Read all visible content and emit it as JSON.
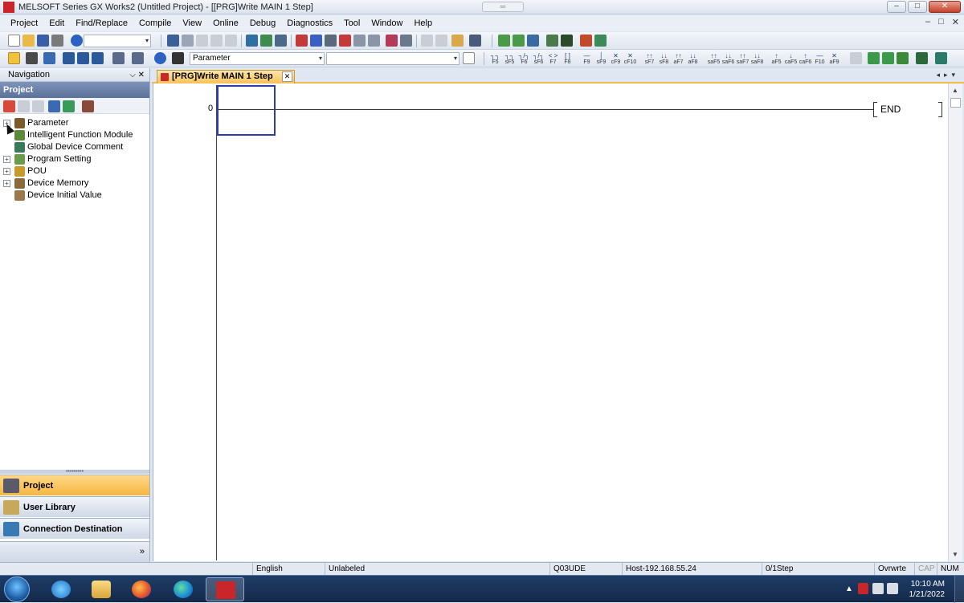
{
  "window": {
    "title": "MELSOFT Series GX Works2 (Untitled Project) - [[PRG]Write MAIN 1 Step]",
    "app_icon_text": "",
    "drag_handle": "═"
  },
  "window_controls": {
    "minimize": "–",
    "maximize": "□",
    "close": "✕"
  },
  "mdi_controls": {
    "minimize": "–",
    "restore": "□",
    "close": "✕"
  },
  "menu": [
    "Project",
    "Edit",
    "Find/Replace",
    "Compile",
    "View",
    "Online",
    "Debug",
    "Diagnostics",
    "Tool",
    "Window",
    "Help"
  ],
  "toolbar2": {
    "parameter_combo": "Parameter",
    "combo_arrow": "▾"
  },
  "fkeys": [
    {
      "sym": "┐┐",
      "key": "F5"
    },
    {
      "sym": "┐┐",
      "key": "sF5"
    },
    {
      "sym": "┐/┐",
      "key": "F6"
    },
    {
      "sym": "┐/┐",
      "key": "sF6"
    },
    {
      "sym": "< >",
      "key": "F7"
    },
    {
      "sym": "[ ]",
      "key": "F8"
    },
    {
      "sym": "—",
      "key": "F9"
    },
    {
      "sym": "│",
      "key": "sF9"
    },
    {
      "sym": "✕",
      "key": "cF9"
    },
    {
      "sym": "✕",
      "key": "cF10"
    },
    {
      "sym": "↑↑",
      "key": "sF7"
    },
    {
      "sym": "↓↓",
      "key": "sF8"
    },
    {
      "sym": "↑↑",
      "key": "aF7"
    },
    {
      "sym": "↓↓",
      "key": "aF8"
    },
    {
      "sym": "↑↑",
      "key": "saF5"
    },
    {
      "sym": "↓↓",
      "key": "saF6"
    },
    {
      "sym": "↑↑",
      "key": "saF7"
    },
    {
      "sym": "↓↓",
      "key": "saF8"
    },
    {
      "sym": "↑",
      "key": "aF5"
    },
    {
      "sym": "↓",
      "key": "caF5"
    },
    {
      "sym": "↑",
      "key": "caF6"
    },
    {
      "sym": "—",
      "key": "F10"
    },
    {
      "sym": "✕",
      "key": "aF9"
    }
  ],
  "navigation": {
    "title": "Navigation",
    "pin": "⌵",
    "close": "✕",
    "project_header": "Project",
    "tree": [
      {
        "label": "Parameter",
        "expander": "+",
        "color": "#7a5a2a"
      },
      {
        "label": "Intelligent Function Module",
        "expander": "",
        "color": "#5a8a3a"
      },
      {
        "label": "Global Device Comment",
        "expander": "",
        "color": "#3a7a5a"
      },
      {
        "label": "Program Setting",
        "expander": "+",
        "color": "#6a9a4a"
      },
      {
        "label": "POU",
        "expander": "+",
        "color": "#c89a2a"
      },
      {
        "label": "Device Memory",
        "expander": "+",
        "color": "#8a6a3a"
      },
      {
        "label": "Device Initial Value",
        "expander": "",
        "color": "#9a7a4a"
      }
    ],
    "splitter": "•••••••••",
    "tabs": [
      {
        "label": "Project",
        "active": true
      },
      {
        "label": "User Library",
        "active": false
      },
      {
        "label": "Connection Destination",
        "active": false
      }
    ],
    "bottom_chevron": "»"
  },
  "document_tab": {
    "label": "[PRG]Write MAIN 1 Step",
    "close": "✕",
    "nav": "◂▸▾"
  },
  "ladder": {
    "step_number": "0",
    "end_instruction": "END"
  },
  "statusbar": {
    "language": "English",
    "label_mode": "Unlabeled",
    "cpu": "Q03UDE",
    "connection": "Host-192.168.55.24",
    "steps": "0/1Step",
    "mode": "Ovrwrte",
    "cap": "CAP",
    "num": "NUM"
  },
  "taskbar": {
    "time": "10:10 AM",
    "date": "1/21/2022",
    "tray_arrow": "▲"
  }
}
